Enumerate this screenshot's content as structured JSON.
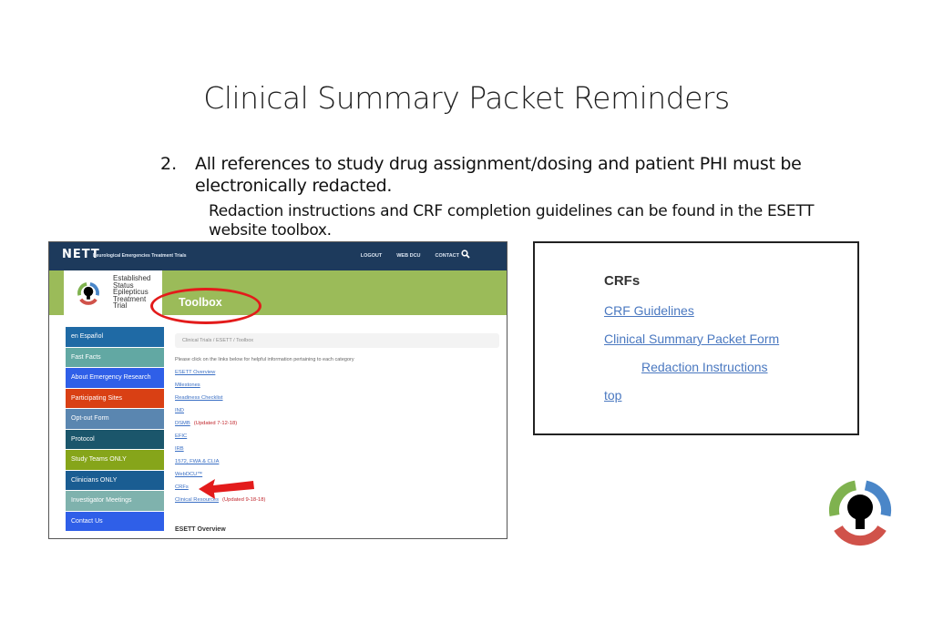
{
  "slide": {
    "title": "Clinical Summary Packet Reminders",
    "bullet_number": "2.",
    "bullet_text": "All references to study drug assignment/dosing and patient PHI must be electronically redacted.",
    "sub_bullet": "Redaction instructions and CRF completion guidelines can be found in the ESETT website toolbox."
  },
  "website": {
    "header": {
      "logo": "NETT",
      "subtitle": "Neurological Emergencies Treatment Trials",
      "nav": [
        "LOGOUT",
        "WEB DCU",
        "CONTACT"
      ],
      "search_icon": "search-icon"
    },
    "brand_lines": [
      "Established",
      "Status",
      "Epilepticus",
      "Treatment",
      "Trial"
    ],
    "page_title": "Toolbox",
    "menu": [
      {
        "label": "en Español",
        "color": "#1f6aa5"
      },
      {
        "label": "Fast Facts",
        "color": "#62a8a3"
      },
      {
        "label": "About Emergency Research",
        "color": "#2f5fe8"
      },
      {
        "label": "Participating Sites",
        "color": "#d94014"
      },
      {
        "label": "Opt-out Form",
        "color": "#5a86b0"
      },
      {
        "label": "Protocol",
        "color": "#1b566b"
      },
      {
        "label": "Study Teams ONLY",
        "color": "#86a51a"
      },
      {
        "label": "Clinicians ONLY",
        "color": "#1a5d92"
      },
      {
        "label": "Investigator Meetings",
        "color": "#7fb2ad"
      },
      {
        "label": "Contact Us",
        "color": "#2f5fe8"
      }
    ],
    "breadcrumb": "Clinical Trials / ESETT / Toolbox",
    "intro": "Please click on the links below for helpful information pertaining to each category",
    "links": [
      {
        "label": "ESETT Overview",
        "note": ""
      },
      {
        "label": "Milestones",
        "note": ""
      },
      {
        "label": "Readiness Checklist",
        "note": ""
      },
      {
        "label": "IND",
        "note": ""
      },
      {
        "label": "DSMB",
        "note": "(Updated 7-12-18)"
      },
      {
        "label": "EFIC",
        "note": ""
      },
      {
        "label": "IRB",
        "note": ""
      },
      {
        "label": "1572, FWA & CLIA",
        "note": ""
      },
      {
        "label": "WebDCU™",
        "note": ""
      },
      {
        "label": "CRFs",
        "note": ""
      },
      {
        "label": "Clinical Resources",
        "note": "(Updated 9-18-18)"
      }
    ],
    "section_heading": "ESETT Overview"
  },
  "crf_panel": {
    "title": "CRFs",
    "links": [
      "CRF Guidelines",
      "Clinical Summary Packet Form",
      "Redaction Instructions",
      "top"
    ]
  },
  "colors": {
    "header_navy": "#1d3a5c",
    "banner_green": "#9bbb59",
    "annotation_red": "#e31b1b",
    "link_blue": "#4a78c0",
    "logo_green": "#7fb24f",
    "logo_blue": "#4a86c8",
    "logo_red": "#d0524a"
  }
}
